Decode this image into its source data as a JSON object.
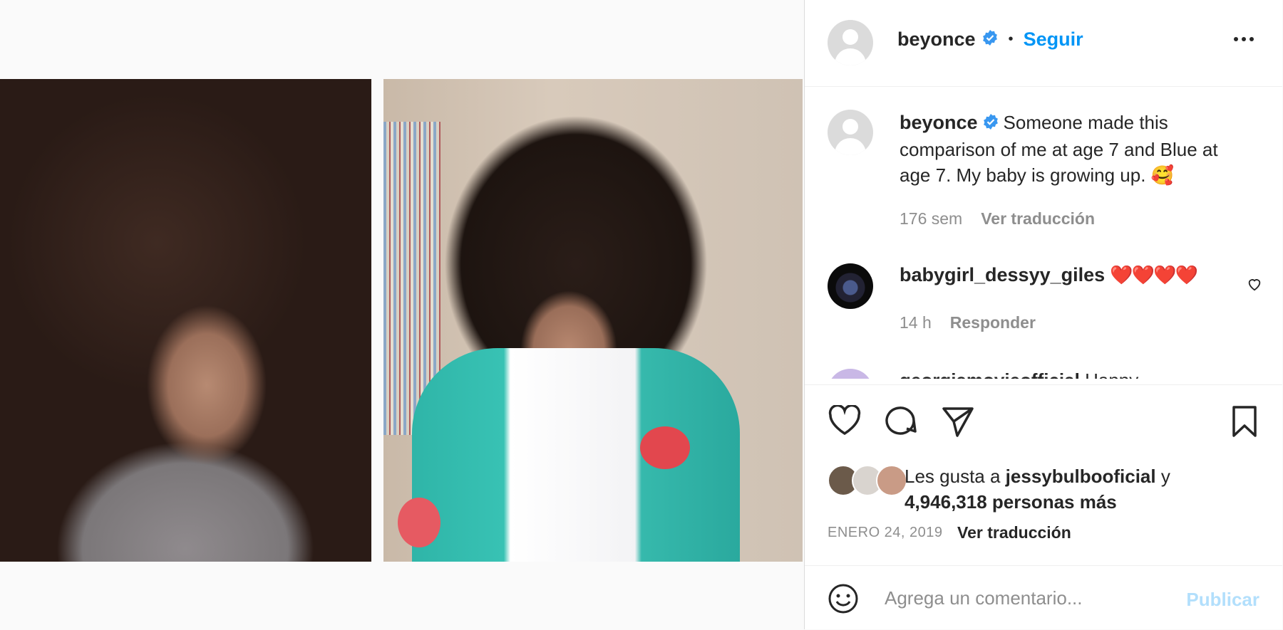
{
  "post": {
    "username": "beyonce",
    "follow_label": "Seguir",
    "dot": "•"
  },
  "caption": {
    "username": "beyonce",
    "text": "Someone made this comparison of me at age 7 and Blue at age 7. My baby is growing up. 🥰",
    "time": "176 sem",
    "translate": "Ver traducción"
  },
  "comments": [
    {
      "username": "babygirl_dessyy_giles",
      "text": "❤️❤️❤️❤️",
      "time": "14 h",
      "reply": "Responder"
    },
    {
      "username": "georgiamovieofficial",
      "text": "Happy"
    }
  ],
  "likes": {
    "prefix": "Les gusta a",
    "user": "jessybulbooficial",
    "joiner": "y",
    "count_text": "4,946,318 personas más"
  },
  "date": {
    "text": "ENERO 24, 2019",
    "translate": "Ver traducción"
  },
  "composer": {
    "placeholder": "Agrega un comentario...",
    "publish": "Publicar"
  },
  "colors": {
    "accent": "#0095f6",
    "verified": "#3897f0",
    "publish_disabled": "#b2dffc"
  },
  "icons": [
    "verified-badge-icon",
    "more-options-icon",
    "heart-icon",
    "comment-icon",
    "share-icon",
    "bookmark-icon",
    "emoji-icon"
  ]
}
